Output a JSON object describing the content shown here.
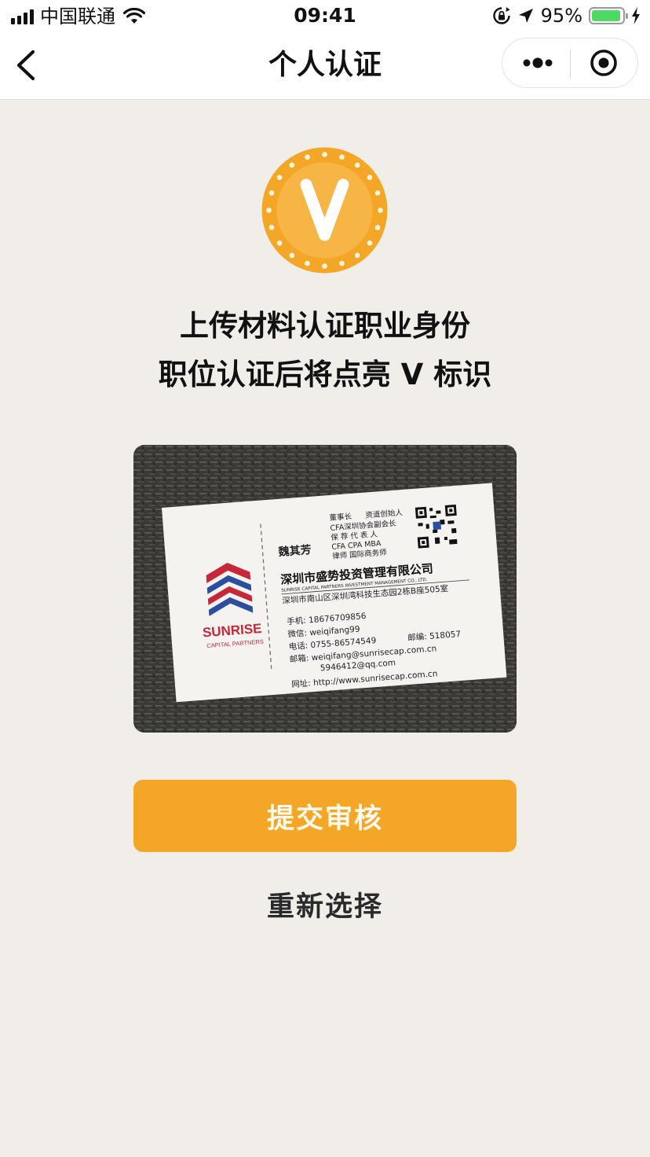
{
  "status_bar": {
    "carrier": "中国联通",
    "time": "09:41",
    "battery_percent": "95%",
    "battery_level": 0.95,
    "icons": [
      "signal-icon",
      "wifi-icon",
      "rotation-lock-icon",
      "location-icon",
      "battery-icon",
      "charging-icon"
    ]
  },
  "nav": {
    "title": "个人认证",
    "back_icon": "chevron-left-icon",
    "more_icon": "more-dots-icon",
    "close_icon": "target-close-icon"
  },
  "badge": {
    "letter": "V",
    "color": "#f4a726"
  },
  "headline": {
    "line1": "上传材料认证职业身份",
    "line2": "职位认证后将点亮 V 标识"
  },
  "card": {
    "company_logo_text": "SUNRISE",
    "company_logo_sub": "CAPITAL PARTNERS",
    "name": "魏其芳",
    "titles": [
      "董事长",
      "资道创始人",
      "CFA深圳协会副会长",
      "保 荐 代 表 人",
      "CFA CPA MBA",
      "律师 国际商务师"
    ],
    "company": "深圳市盛势投资管理有限公司",
    "company_en": "SUNRISE CAPITAL PARTNERS INVESTMENT MANAGEMENT CO., LTD.",
    "address": "深圳市南山区深圳湾科技生态园2栋B座505室",
    "mobile": "手机: 18676709856",
    "wechat": "微信: weiqifang99",
    "phone": "电话: 0755-86574549",
    "postcode": "邮编: 518057",
    "email1": "邮箱: weiqifang@sunrisecap.com.cn",
    "email2": "5946412@qq.com",
    "website": "网址: http://www.sunrisecap.com.cn"
  },
  "actions": {
    "submit_label": "提交审核",
    "reselect_label": "重新选择",
    "submit_color": "#f4a726"
  }
}
